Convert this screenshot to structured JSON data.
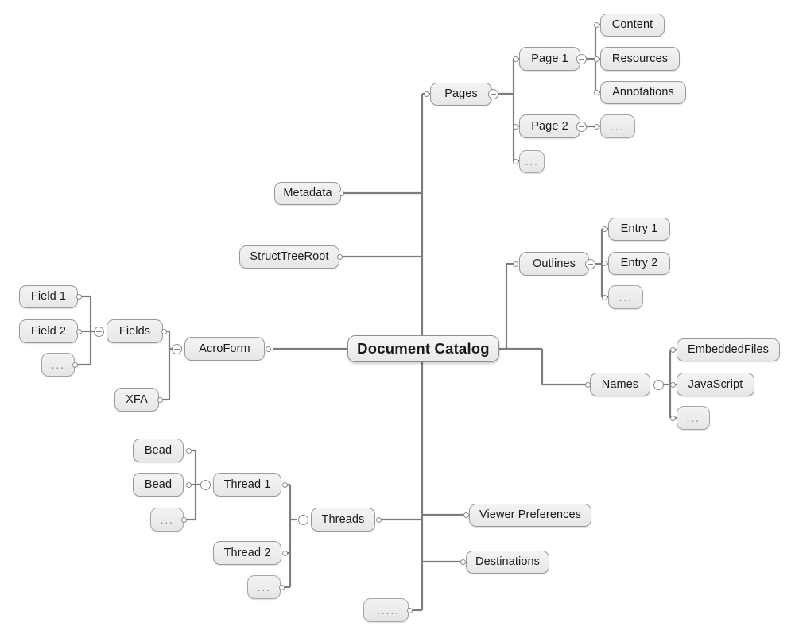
{
  "diagram": {
    "title": "Document Catalog",
    "type": "mind-map",
    "root": {
      "label": "Document Catalog"
    },
    "colors": {
      "node_fill": "#eceded",
      "node_border": "#9a9a9a",
      "connector": "#7d7d7d",
      "text": "#1a1a1a",
      "dots_text": "#8b8b8b",
      "background": "#ffffff"
    },
    "icons": {
      "collapse": "circled-minus",
      "attach_point": "hollow-circle"
    },
    "nodes": {
      "pages": "Pages",
      "page1": "Page 1",
      "page2": "Page 2",
      "pages_more": "...",
      "content": "Content",
      "resources": "Resources",
      "annotations": "Annotations",
      "page2_more": "...",
      "metadata": "Metadata",
      "structtreeroot": "StructTreeRoot",
      "outlines": "Outlines",
      "entry1": "Entry 1",
      "entry2": "Entry 2",
      "outlines_more": "...",
      "names": "Names",
      "embeddedfiles": "EmbeddedFiles",
      "javascript": "JavaScript",
      "names_more": "...",
      "acroform": "AcroForm",
      "fields": "Fields",
      "field1": "Field 1",
      "field2": "Field 2",
      "fields_more": "...",
      "xfa": "XFA",
      "threads": "Threads",
      "thread1": "Thread 1",
      "thread2": "Thread 2",
      "threads_more": "...",
      "bead1": "Bead",
      "bead2": "Bead",
      "beads_more": "...",
      "viewer_preferences": "Viewer Preferences",
      "destinations": "Destinations",
      "catalog_more": "......"
    }
  }
}
